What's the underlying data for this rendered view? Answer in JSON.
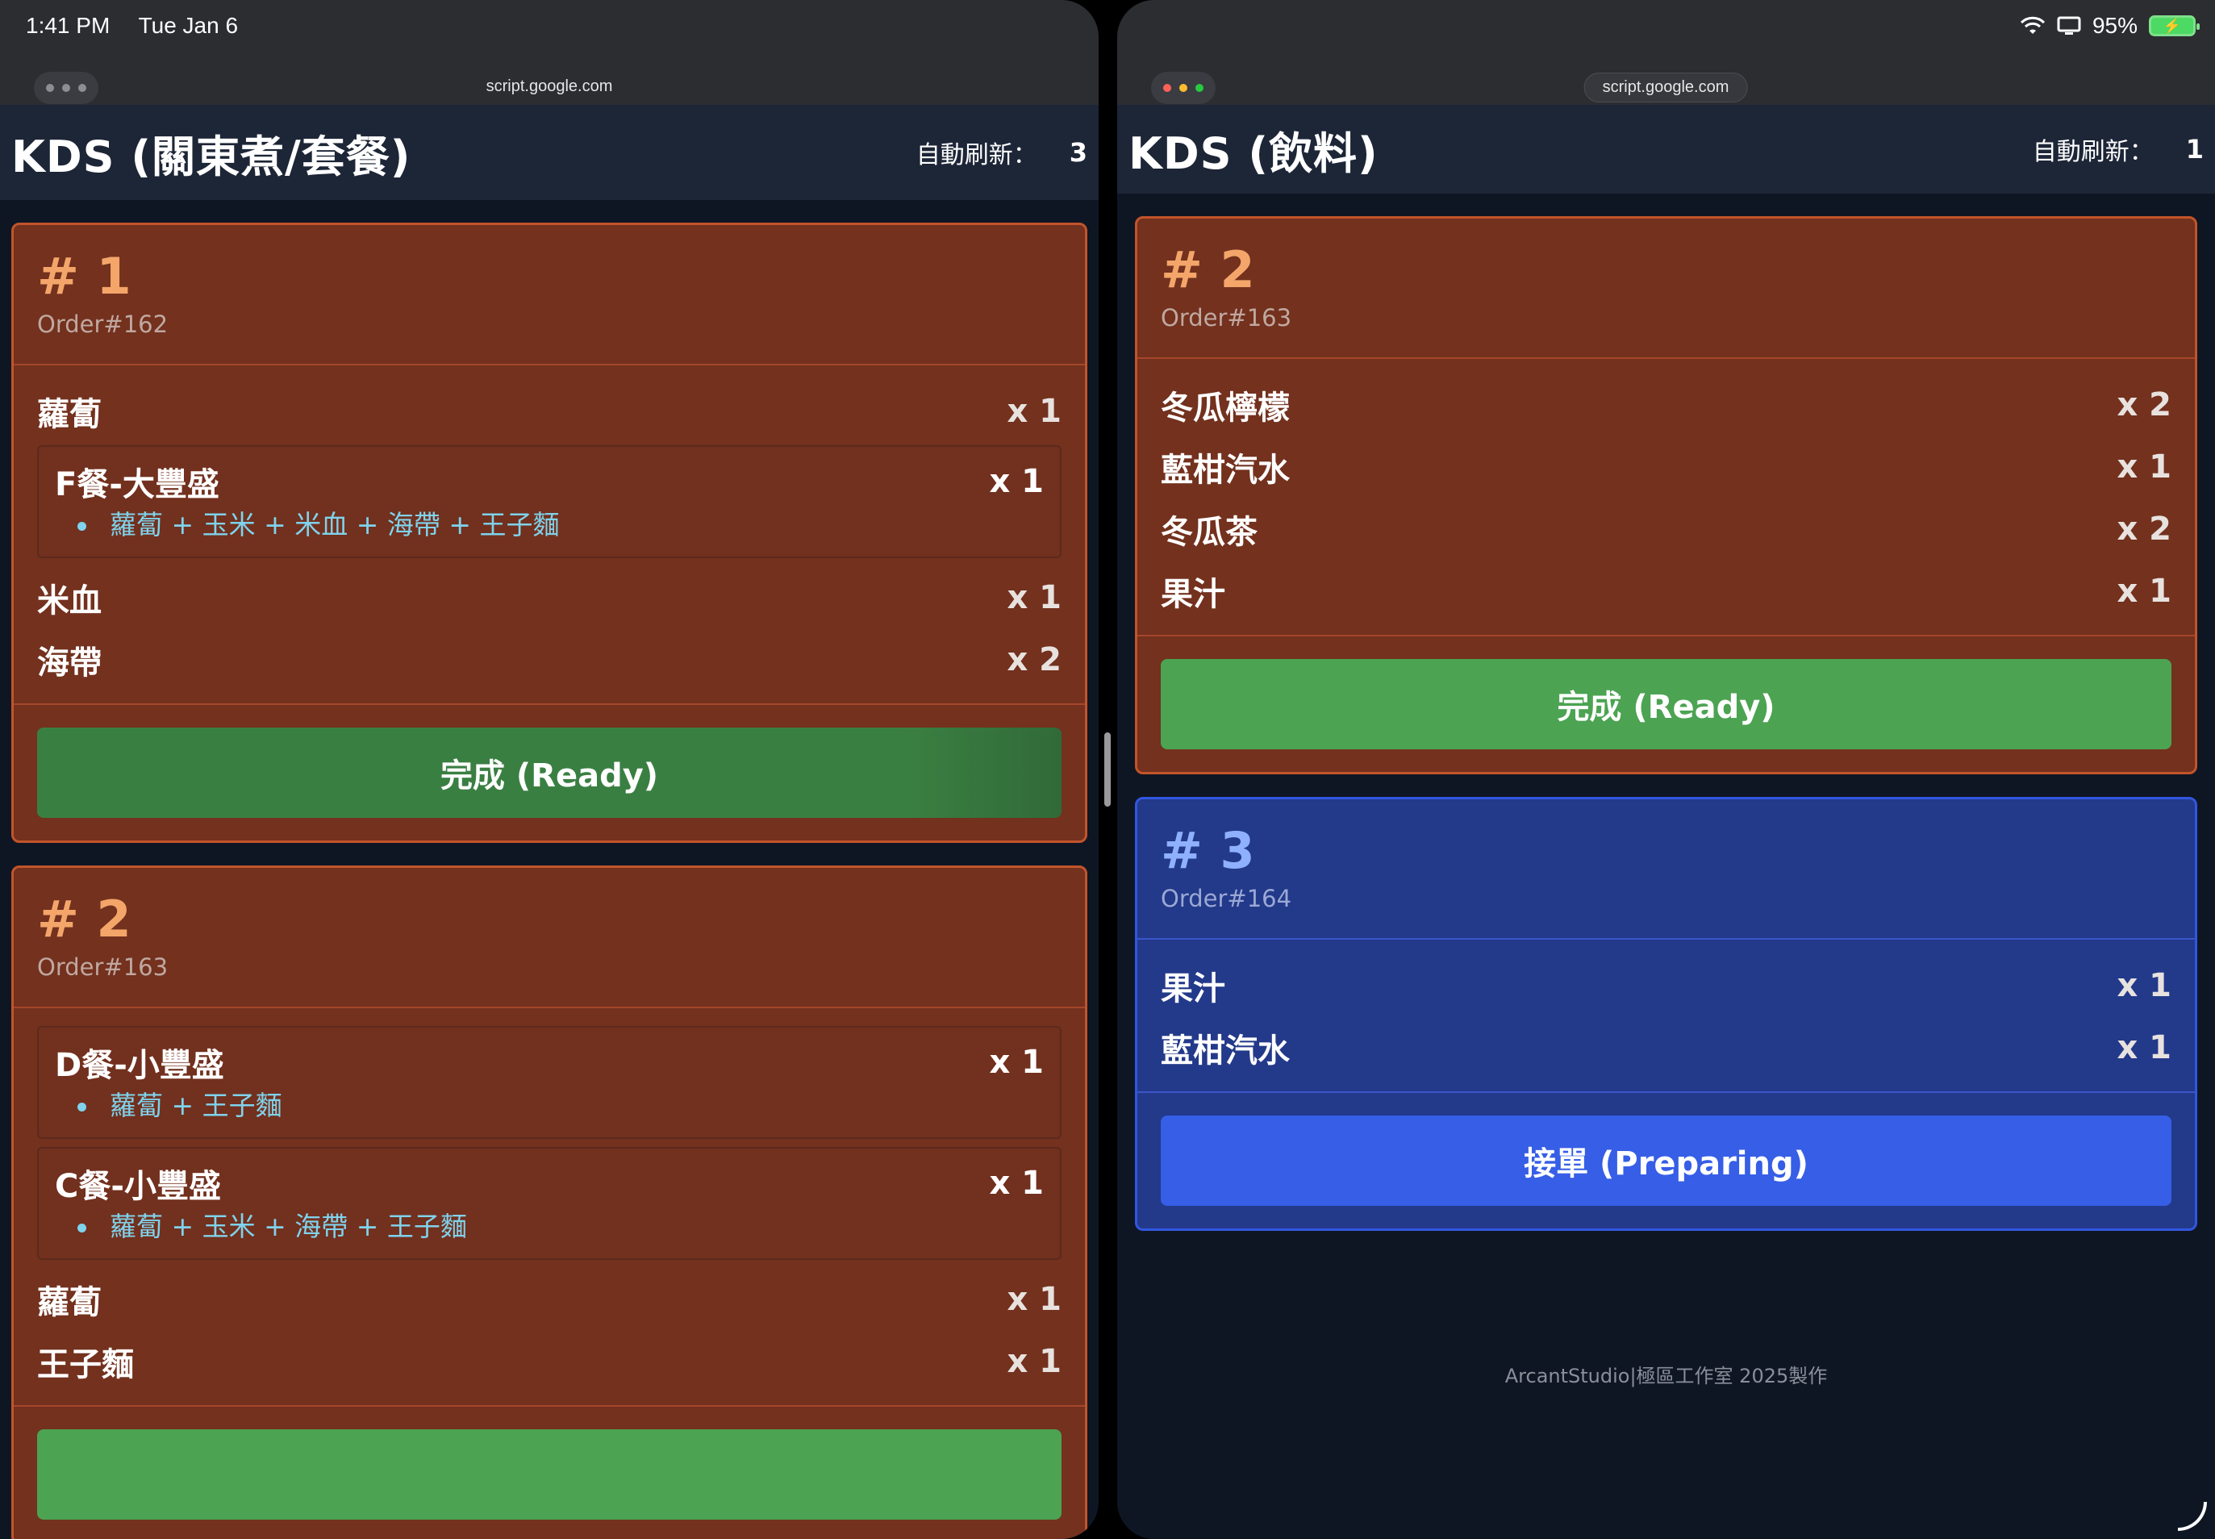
{
  "status": {
    "time": "1:41 PM",
    "date": "Tue Jan 6",
    "battery": "95%"
  },
  "left": {
    "url": "script.google.com",
    "title": "KDS (關東煮/套餐)",
    "refresh_label": "自動刷新：",
    "refresh_count": "3",
    "orders": [
      {
        "num": "# 1",
        "order": "Order#162",
        "items": [
          {
            "name": "蘿蔔",
            "qty": "x 1"
          }
        ],
        "combo": {
          "name": "F餐-大豐盛",
          "qty": "x 1",
          "detail": "蘿蔔 + 玉米 + 米血 + 海帶 + 王子麵"
        },
        "items2": [
          {
            "name": "米血",
            "qty": "x 1"
          },
          {
            "name": "海帶",
            "qty": "x 2"
          }
        ],
        "button": "完成 (Ready)"
      },
      {
        "num": "# 2",
        "order": "Order#163",
        "combos": [
          {
            "name": "D餐-小豐盛",
            "qty": "x 1",
            "detail": "蘿蔔 + 王子麵"
          },
          {
            "name": "C餐-小豐盛",
            "qty": "x 1",
            "detail": "蘿蔔 + 玉米 + 海帶 + 王子麵"
          }
        ],
        "items": [
          {
            "name": "蘿蔔",
            "qty": "x 1"
          },
          {
            "name": "王子麵",
            "qty": "x 1"
          }
        ]
      }
    ]
  },
  "right": {
    "url": "script.google.com",
    "title": "KDS (飲料)",
    "refresh_label": "自動刷新：",
    "refresh_count": "1",
    "orders": [
      {
        "num": "# 2",
        "order": "Order#163",
        "items": [
          {
            "name": "冬瓜檸檬",
            "qty": "x 2"
          },
          {
            "name": "藍柑汽水",
            "qty": "x 1"
          },
          {
            "name": "冬瓜茶",
            "qty": "x 2"
          },
          {
            "name": "果汁",
            "qty": "x 1"
          }
        ],
        "button": "完成 (Ready)"
      },
      {
        "num": "# 3",
        "order": "Order#164",
        "items": [
          {
            "name": "果汁",
            "qty": "x 1"
          },
          {
            "name": "藍柑汽水",
            "qty": "x 1"
          }
        ],
        "button": "接單 (Preparing)"
      }
    ],
    "footer": "ArcantStudio|極區工作室 2025製作"
  },
  "colors": {
    "card_orange": "#73311e",
    "card_blue": "#23398a",
    "ready_green": "#4ca352",
    "preparing_blue": "#365ee6",
    "combo_detail": "#7fd3ec"
  },
  "icons": [
    "wifi-icon",
    "screen-mirror-icon",
    "battery-icon",
    "window-menu-icon"
  ]
}
